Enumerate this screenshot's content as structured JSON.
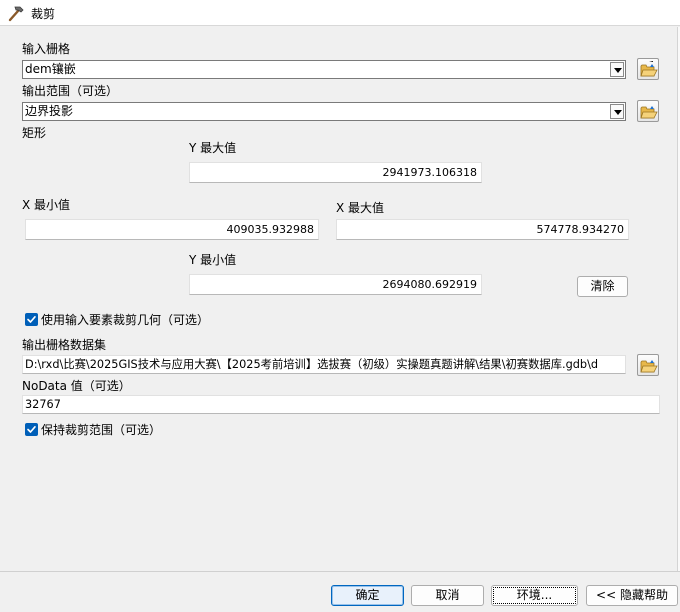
{
  "window": {
    "title": "裁剪",
    "icon": "hammer-icon"
  },
  "input_raster": {
    "label": "输入栅格",
    "value": "dem镶嵌"
  },
  "output_extent": {
    "label": "输出范围（可选）",
    "value": "边界投影"
  },
  "rectangle": {
    "label": "矩形",
    "y_max_label": "Y 最大值",
    "y_max": "2941973.106318",
    "x_min_label": "X 最小值",
    "x_min": "409035.932988",
    "x_max_label": "X 最大值",
    "x_max": "574778.934270",
    "y_min_label": "Y 最小值",
    "y_min": "2694080.692919",
    "clear_label": "清除"
  },
  "use_input_geometry": {
    "label": "使用输入要素裁剪几何（可选）",
    "checked": true
  },
  "output_raster": {
    "label": "输出栅格数据集",
    "value": "D:\\rxd\\比赛\\2025GIS技术与应用大赛\\【2025考前培训】选拔赛（初级）实操题真题讲解\\结果\\初赛数据库.gdb\\d"
  },
  "nodata": {
    "label": "NoData 值（可选）",
    "value": "32767"
  },
  "maintain_extent": {
    "label": "保持裁剪范围（可选）",
    "checked": true
  },
  "buttons": {
    "ok": "确定",
    "cancel": "取消",
    "env": "环境...",
    "hide_help": "<< 隐藏帮助"
  },
  "colors": {
    "accent": "#005fb8",
    "primary_border": "#0067c0",
    "background": "#f0f0f0"
  }
}
